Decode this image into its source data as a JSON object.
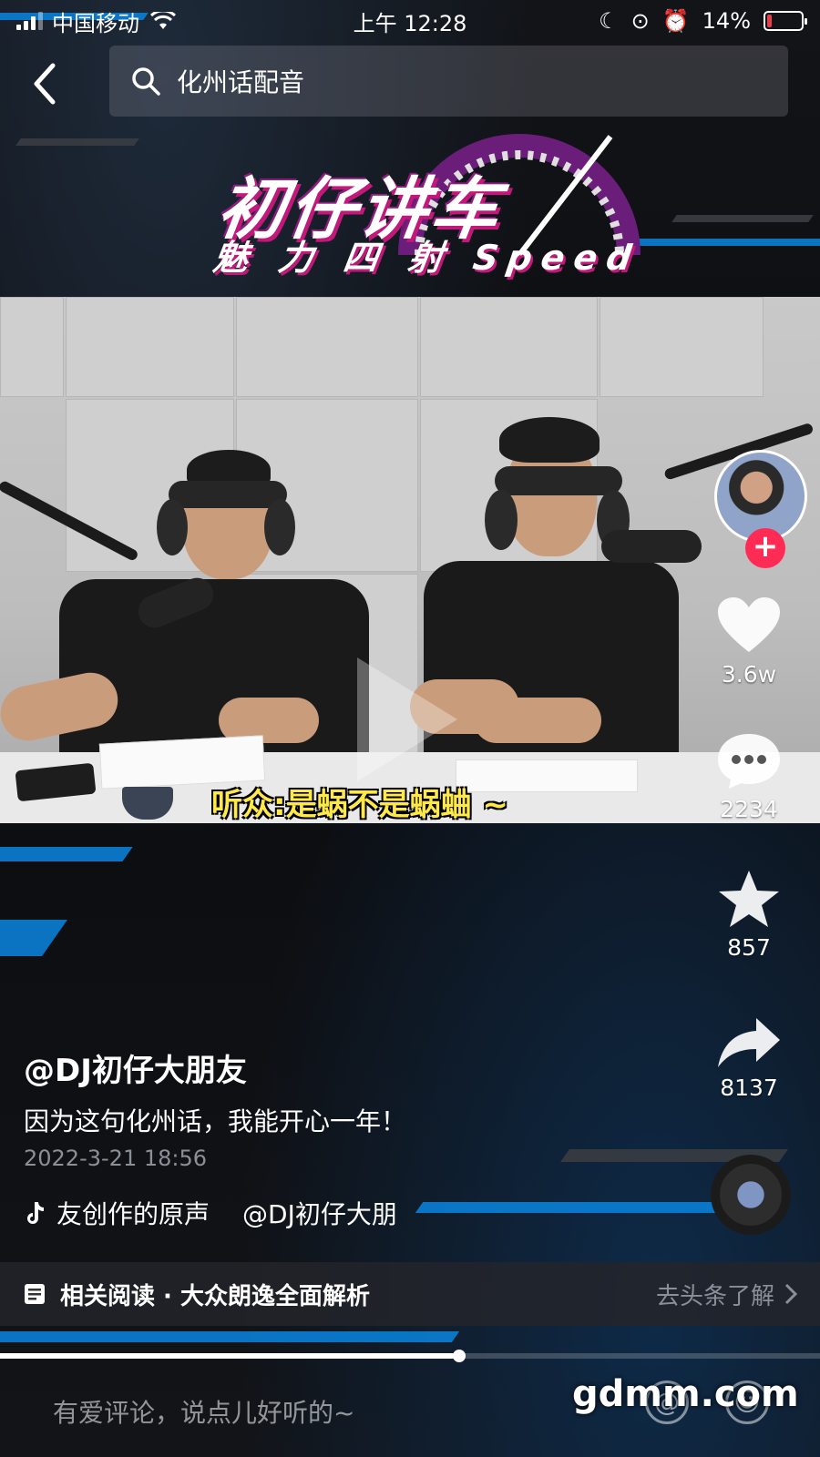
{
  "status_bar": {
    "carrier": "中国移动",
    "time": "上午 12:28",
    "battery_percent": "14%",
    "battery_level": 0.14
  },
  "search": {
    "query": "化州话配音"
  },
  "banner": {
    "title": "初仔讲车",
    "subtitle": "魅 力 四 射 Speed"
  },
  "video": {
    "caption": "听众:是蜗不是蜗蛐 ~"
  },
  "actions": {
    "likes": "3.6w",
    "comments": "2234",
    "favorites": "857",
    "shares": "8137"
  },
  "post": {
    "author": "@DJ初仔大朋友",
    "description": "因为这句化州话，我能开心一年！",
    "date": "2022-3-21 18:56",
    "music_title": "友创作的原声",
    "music_author": "@DJ初仔大朋"
  },
  "related": {
    "label": "相关阅读 · 大众朗逸全面解析",
    "link": "去头条了解"
  },
  "playback": {
    "progress": 0.56
  },
  "comment_input": {
    "placeholder": "有爱评论，说点儿好听的~"
  },
  "watermark": "gdmm.com",
  "colors": {
    "accent_red": "#fe2c55",
    "stripe_blue": "#0a7fd6",
    "caption_yellow": "#ffe84a"
  }
}
